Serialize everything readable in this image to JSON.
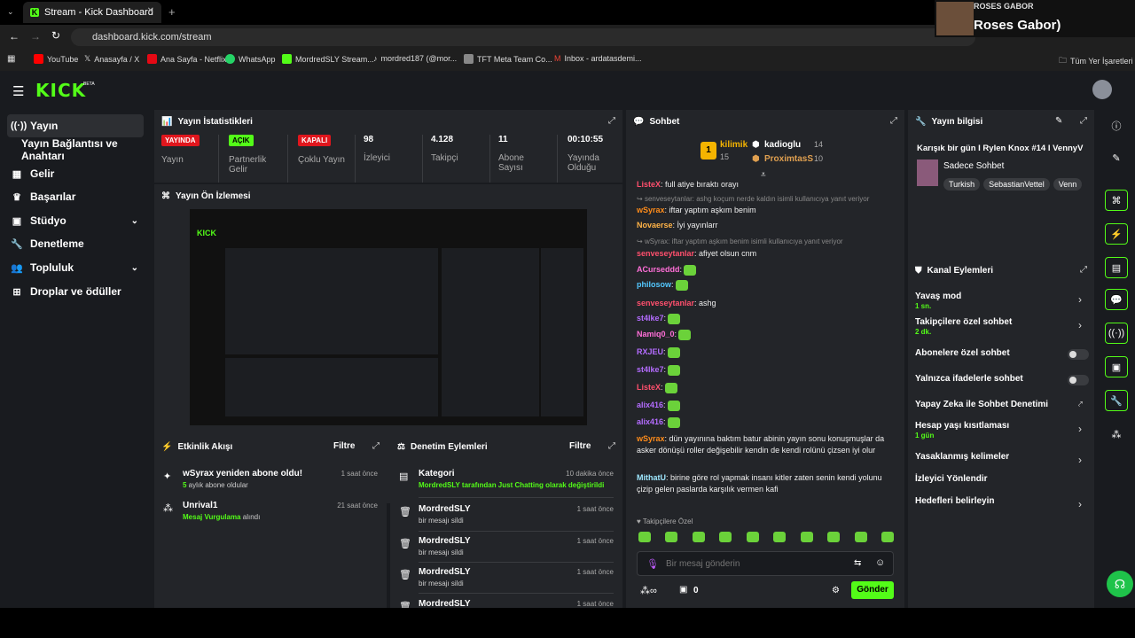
{
  "browser": {
    "tab_title": "Stream - Kick Dashboard",
    "url": "dashboard.kick.com/stream",
    "bookmarks": [
      "YouTube",
      "Anasayfa / X",
      "Ana Sayfa - Netflix",
      "WhatsApp",
      "MordredSLY Stream...",
      "mordred187 (@mor...",
      "TFT Meta Team Co...",
      "Inbox - ardatasdemi..."
    ],
    "all_bookmarks": "Tüm Yer İşaretleri"
  },
  "overlay": {
    "line1": "ROSES GABOR",
    "line2": "Roses Gabor)"
  },
  "app": {
    "logo": "KICK",
    "beta": "BETA"
  },
  "sidebar": {
    "items": [
      "Yayın",
      "Yayın Bağlantısı ve Anahtarı",
      "Gelir",
      "Başarılar",
      "Stüdyo",
      "Denetleme",
      "Topluluk",
      "Droplar ve ödüller"
    ]
  },
  "stats": {
    "title": "Yayın İstatistikleri",
    "items": [
      {
        "value": "YAYINDA",
        "label": "Yayın"
      },
      {
        "value": "AÇIK",
        "label": "Partnerlik Gelir"
      },
      {
        "value": "KAPALI",
        "label": "Çoklu Yayın"
      },
      {
        "value": "98",
        "label": "İzleyici"
      },
      {
        "value": "4.128",
        "label": "Takipçi"
      },
      {
        "value": "11",
        "label": "Abone Sayısı"
      },
      {
        "value": "00:10:55",
        "label": "Yayında Olduğu"
      }
    ]
  },
  "preview": {
    "title": "Yayın Ön İzlemesi"
  },
  "events": {
    "title": "Etkinlik Akışı",
    "filter": "Filtre",
    "items": [
      {
        "title": "wSyrax yeniden abone oldu!",
        "sub_a": "5",
        "sub_b": " aylık abone oldular",
        "time": "1 saat önce"
      },
      {
        "title": "Unrival1",
        "sub_a": "Mesaj Vurgulama",
        "sub_b": " alındı",
        "time": "21 saat önce"
      }
    ]
  },
  "mod": {
    "title": "Denetim Eylemleri",
    "filter": "Filtre",
    "items": [
      {
        "title": "Kategori",
        "sub": "MordredSLY tarafından Just Chatting olarak değiştirildi",
        "time": "10 dakika önce"
      },
      {
        "title": "MordredSLY",
        "sub": "bir mesajı sildi",
        "time": "1 saat önce"
      },
      {
        "title": "MordredSLY",
        "sub": "bir mesajı sildi",
        "time": "1 saat önce"
      },
      {
        "title": "MordredSLY",
        "sub": "bir mesajı sildi",
        "time": "1 saat önce"
      },
      {
        "title": "MordredSLY",
        "sub": "",
        "time": "1 saat önce"
      }
    ]
  },
  "chat": {
    "title": "Sohbet",
    "leaders": [
      {
        "name": "kilimik",
        "count": "15"
      },
      {
        "name": "kadioglu",
        "count": "14"
      },
      {
        "name": "ProximtasS",
        "count": "10"
      }
    ],
    "messages": [
      {
        "name": "ListeX",
        "color": "#ff4f6d",
        "text": ": full atiye bıraktı orayı"
      },
      {
        "reply": "senveseytanlar: ashg koçum nerde kaldın isimli kullanıcıya yanıt veriyor"
      },
      {
        "name": "wSyrax",
        "color": "#ff8c1a",
        "text": ": iftar yaptım aşkım benim"
      },
      {
        "name": "Novaerse",
        "color": "#ffb347",
        "text": ": İyi yayınlarr"
      },
      {
        "reply": "wSyrax: iftar yaptım aşkım benim isimli kullanıcıya yanıt veriyor"
      },
      {
        "name": "senveseytanlar",
        "color": "#ff4f6d",
        "text": ": afiyet olsun cnm"
      },
      {
        "name": "ACurseddd",
        "color": "#ff6fd8",
        "text": ":"
      },
      {
        "name": "philosow",
        "color": "#53c8ff",
        "text": ":"
      },
      {
        "name": "senveseytanlar",
        "color": "#ff4f6d",
        "text": ": ashg"
      },
      {
        "name": "st4lke7",
        "color": "#b46cff",
        "text": ":"
      },
      {
        "name": "Namiq0_0",
        "color": "#ff6fd8",
        "text": ":"
      },
      {
        "name": "RXJEU",
        "color": "#b46cff",
        "text": ":"
      },
      {
        "name": "st4lke7",
        "color": "#b46cff",
        "text": ":"
      },
      {
        "name": "ListeX",
        "color": "#ff4f6d",
        "text": ":"
      },
      {
        "name": "alix416",
        "color": "#b46cff",
        "text": ":"
      },
      {
        "name": "alix416",
        "color": "#b46cff",
        "text": ":"
      },
      {
        "name": "wSyrax",
        "color": "#ff8c1a",
        "text": ": dün yayınına baktım batur abinin yayın sonu konuşmuşlar da asker dönüşü roller değişebilir kendin de kendi rolünü çizsen iyi olur"
      },
      {
        "name": "MithatU",
        "color": "#9fe8ff",
        "text": ": birine göre rol yapmak insanı kitler zaten senin kendi yolunu çizip gelen paslarda karşılık vermen kafi"
      }
    ],
    "followers_only": "Takipçilere Özel",
    "placeholder": "Bir mesaj gönderin",
    "points": "0",
    "send": "Gönder"
  },
  "info": {
    "title": "Yayın bilgisi",
    "stream_title": "Karışık bir gün I Rylen Knox #14 I VennyV",
    "category": "Sadece Sohbet",
    "tags": [
      "Turkish",
      "SebastianVettel",
      "Venn"
    ]
  },
  "channel": {
    "title": "Kanal Eylemleri",
    "rows": [
      {
        "label": "Yavaş mod",
        "sub": "1 sn."
      },
      {
        "label": "Takipçilere özel sohbet",
        "sub": "2 dk."
      },
      {
        "label": "Abonelere özel sohbet",
        "sub": ""
      },
      {
        "label": "Yalnızca ifadelerle sohbet",
        "sub": ""
      },
      {
        "label": "Yapay Zeka ile Sohbet Denetimi",
        "sub": ""
      },
      {
        "label": "Hesap yaşı kısıtlaması",
        "sub": "1 gün"
      },
      {
        "label": "Yasaklanmış kelimeler",
        "sub": ""
      },
      {
        "label": "İzleyici Yönlendir",
        "sub": ""
      },
      {
        "label": "Hedefleri belirleyin",
        "sub": ""
      }
    ]
  },
  "colors": {
    "accent": "#53fc18",
    "live": "#e0161d",
    "panel": "#232529"
  }
}
